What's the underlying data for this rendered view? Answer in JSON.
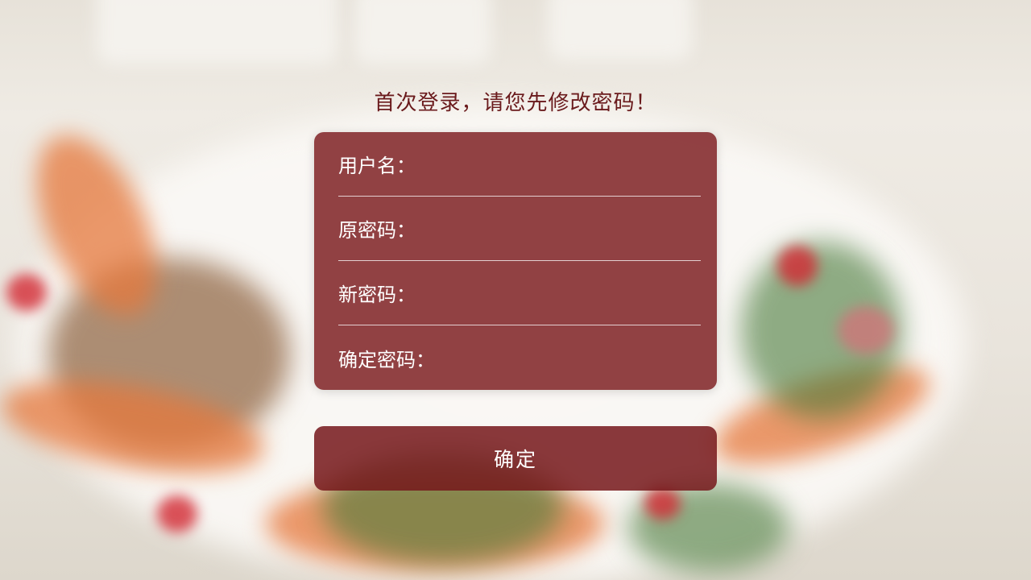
{
  "headline": "首次登录，请您先修改密码！",
  "form": {
    "fields": [
      {
        "label": "用户名：",
        "value": ""
      },
      {
        "label": "原密码：",
        "value": ""
      },
      {
        "label": "新密码：",
        "value": ""
      },
      {
        "label": "确定密码：",
        "value": ""
      }
    ],
    "submit_label": "确定"
  },
  "colors": {
    "panel": "#7a181c",
    "headline": "#6a1a1c",
    "text": "#ffffff"
  }
}
